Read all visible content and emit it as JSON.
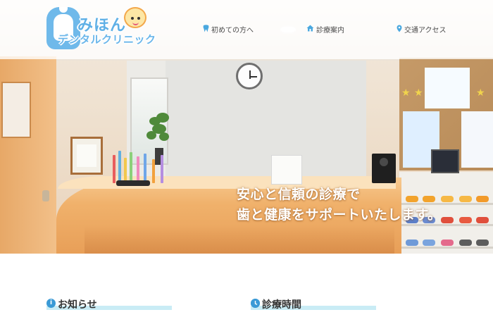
{
  "brand": {
    "name_top": "みほん",
    "name_bottom": "デンタルクリニック"
  },
  "nav": [
    {
      "label": "初めての方へ",
      "icon": "tooth-icon"
    },
    {
      "label": "診療案内",
      "icon": "home-icon"
    },
    {
      "label": "交通アクセス",
      "icon": "map-pin-icon"
    }
  ],
  "hero": {
    "line1": "安心と信頼の診療で",
    "line2": "歯と健康をサポートいたします。"
  },
  "sections": {
    "news": {
      "title": "お知らせ",
      "icon": "info-icon"
    },
    "hours": {
      "title": "診療時間",
      "icon": "clock-icon"
    }
  },
  "colors": {
    "accent": "#3a9ad6",
    "brand_blue": "#5fb0e6",
    "underline": "#c9ecf5"
  }
}
